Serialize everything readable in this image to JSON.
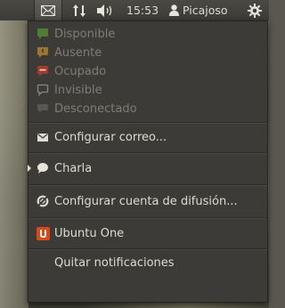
{
  "panel": {
    "clock": "15:53",
    "user": "Picajoso",
    "icons": [
      "mail-icon",
      "network-icon",
      "volume-icon",
      "user-icon",
      "power-gear-icon"
    ]
  },
  "menu": {
    "status": [
      {
        "label": "Disponible",
        "icon": "status-available-icon",
        "color": "#5a9a3a"
      },
      {
        "label": "Ausente",
        "icon": "status-away-icon",
        "color": "#b8862a"
      },
      {
        "label": "Ocupado",
        "icon": "status-busy-icon",
        "color": "#c0392b"
      },
      {
        "label": "Invisible",
        "icon": "status-invisible-icon",
        "color": "#8a8780"
      },
      {
        "label": "Desconectado",
        "icon": "status-offline-icon",
        "color": "#6a6862"
      }
    ],
    "configure_mail": "Configurar correo...",
    "chat": "Charla",
    "configure_broadcast": "Configurar cuenta de difusión...",
    "ubuntu_one": "Ubuntu One",
    "clear_notifications": "Quitar notificaciones"
  }
}
